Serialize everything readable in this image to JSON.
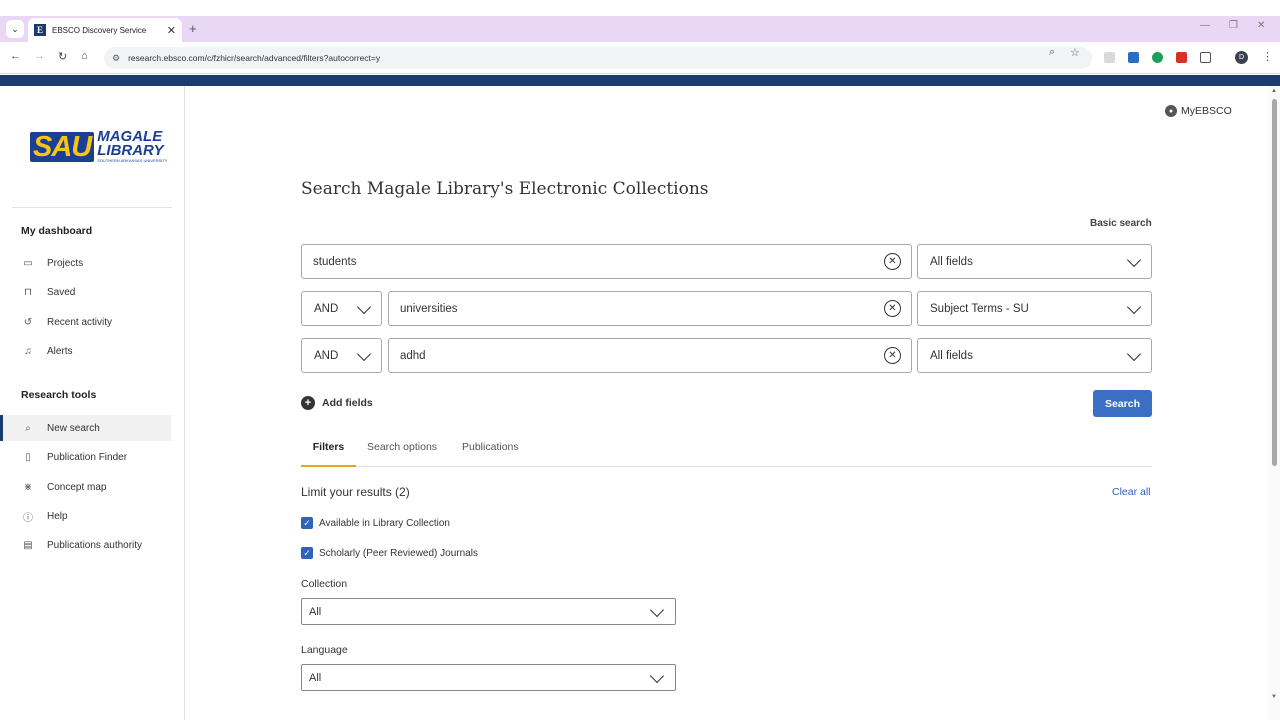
{
  "browser": {
    "tab_title": "EBSCO Discovery Service",
    "tab_favicon": "E",
    "url": "research.ebsco.com/c/fzhicr/search/advanced/filters?autocorrect=y",
    "profile_initial": "D"
  },
  "header": {
    "myebsco_label": "MyEBSCO"
  },
  "logo": {
    "sau": "SAU",
    "line1": "MAGALE",
    "line2": "LIBRARY",
    "tagline": "SOUTHERN ARKANSAS UNIVERSITY"
  },
  "sidebar": {
    "dashboard_heading": "My dashboard",
    "dashboard_items": [
      {
        "label": "Projects",
        "icon": "folder-icon"
      },
      {
        "label": "Saved",
        "icon": "bookmark-icon"
      },
      {
        "label": "Recent activity",
        "icon": "history-icon"
      },
      {
        "label": "Alerts",
        "icon": "bell-icon"
      }
    ],
    "tools_heading": "Research tools",
    "tools_items": [
      {
        "label": "New search",
        "icon": "search-icon"
      },
      {
        "label": "Publication Finder",
        "icon": "document-icon"
      },
      {
        "label": "Concept map",
        "icon": "concept-map-icon"
      },
      {
        "label": "Help",
        "icon": "help-icon"
      },
      {
        "label": "Publications authority",
        "icon": "authority-icon"
      }
    ]
  },
  "main": {
    "title": "Search Magale Library's Electronic Collections",
    "basic_search": "Basic search",
    "rows": [
      {
        "operator": "",
        "term": "students",
        "field": "All fields"
      },
      {
        "operator": "AND",
        "term": "universities",
        "field": "Subject Terms - SU"
      },
      {
        "operator": "AND",
        "term": "adhd",
        "field": "All fields"
      }
    ],
    "add_fields": "Add fields",
    "search_button": "Search",
    "tabs": [
      "Filters",
      "Search options",
      "Publications"
    ],
    "active_tab": "Filters",
    "limit_heading": "Limit your results (2)",
    "clear_all": "Clear all",
    "limits": [
      {
        "label": "Available in Library Collection",
        "checked": true
      },
      {
        "label": "Scholarly (Peer Reviewed) Journals",
        "checked": true
      }
    ],
    "collection_label": "Collection",
    "collection_value": "All",
    "language_label": "Language",
    "language_value": "All"
  },
  "colors": {
    "brand_navy": "#1a3c6e",
    "primary_button": "#3a6fc4",
    "tab_underline": "#e8a321",
    "link": "#2e5fb3"
  }
}
